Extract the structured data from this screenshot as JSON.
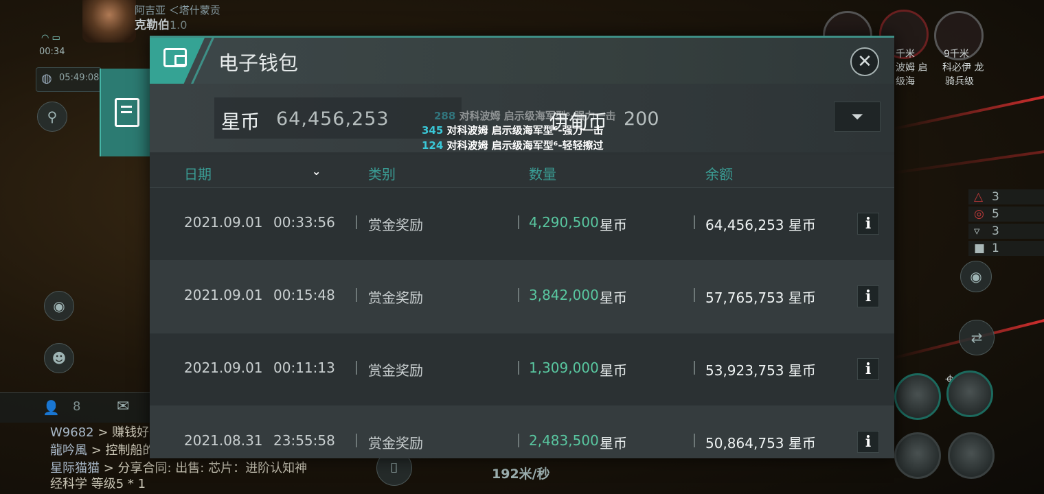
{
  "hud": {
    "pilot_corp": "阿吉亚 ＜塔什蒙贡",
    "pilot_name": "克勒伯",
    "pilot_sec": "1.0",
    "clock": "00:34",
    "timer": "05:49:08",
    "chat_count": "8",
    "chat_lines": [
      {
        "user": "W9682",
        "text": " > 赚钱好难"
      },
      {
        "user": "龍吟風",
        "text": " > 控制船的"
      },
      {
        "user": "星际猫猫",
        "text": " > 分享合同: 出售: 芯片：进阶认知神"
      },
      {
        "user": "",
        "text": "经科学 等级5 * 1"
      }
    ],
    "speed": "192米/秒",
    "targets": [
      {
        "distance": "千米",
        "name": "波姆 启"
      },
      {
        "distance": "9千米",
        "name": "科必伊 龙"
      }
    ],
    "target_sub": [
      "级海",
      "骑兵级"
    ],
    "overview_counts": [
      "3",
      "5",
      "3",
      "1"
    ]
  },
  "wallet": {
    "title": "电子钱包",
    "balances": [
      {
        "label": "星币",
        "value": "64,456,253"
      },
      {
        "label": "伊甸币",
        "value": "200"
      }
    ],
    "columns": {
      "date": "日期",
      "type": "类别",
      "amount": "数量",
      "balance": "余额"
    },
    "rows": [
      {
        "date": "2021.09.01",
        "time": "00:33:56",
        "type": "赏金奖励",
        "amount": "4,290,500",
        "unit": "星币",
        "balance": "64,456,253 星币"
      },
      {
        "date": "2021.09.01",
        "time": "00:15:48",
        "type": "赏金奖励",
        "amount": "3,842,000",
        "unit": "星币",
        "balance": "57,765,753 星币"
      },
      {
        "date": "2021.09.01",
        "time": "00:11:13",
        "type": "赏金奖励",
        "amount": "1,309,000",
        "unit": "星币",
        "balance": "53,923,753 星币"
      },
      {
        "date": "2021.08.31",
        "time": "23:55:58",
        "type": "赏金奖励",
        "amount": "2,483,500",
        "unit": "星币",
        "balance": "50,864,753 星币"
      }
    ]
  },
  "combat_log": [
    {
      "num": "288",
      "text": " 对科波姆 启示级海军型⁶-强力一击"
    },
    {
      "num": "345",
      "text": " 对科波姆 启示级海军型⁶-强力一击"
    },
    {
      "num": "124",
      "text": " 对科波姆 启示级海军型⁶-轻轻擦过"
    }
  ],
  "colors": {
    "accent": "#35a394",
    "positive_amount": "#59c7a0",
    "header_text": "#3a9c94",
    "damage_number": "#3ac8d8"
  },
  "icons": {
    "wallet": "wallet-icon",
    "close": "close-icon",
    "filter": "filter-icon",
    "info": "info-icon",
    "document": "document-icon"
  }
}
